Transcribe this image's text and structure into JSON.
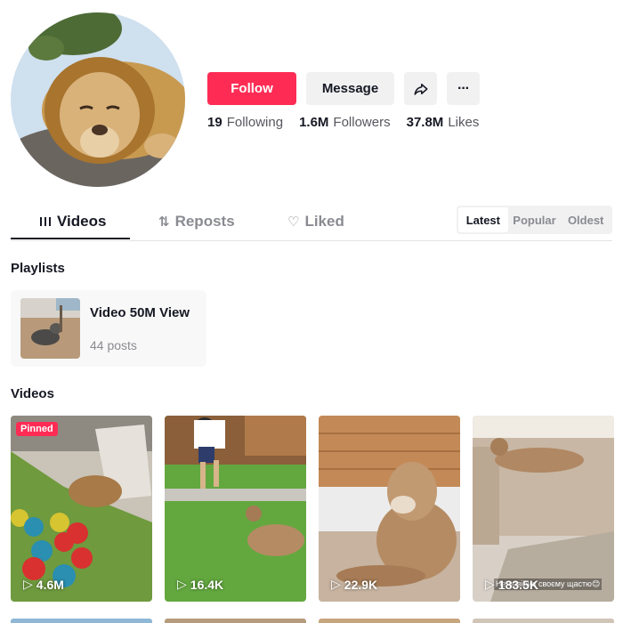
{
  "profile": {
    "avatar_alt": "lion-avatar"
  },
  "actions": {
    "follow_label": "Follow",
    "message_label": "Message",
    "share_icon": "share-icon",
    "more_label": "···"
  },
  "stats": [
    {
      "value": "19",
      "label": "Following"
    },
    {
      "value": "1.6M",
      "label": "Followers"
    },
    {
      "value": "37.8M",
      "label": "Likes"
    }
  ],
  "tabs": [
    {
      "label": "Videos",
      "icon": "grid-icon",
      "active": true
    },
    {
      "label": "Reposts",
      "icon": "repost-icon",
      "active": false
    },
    {
      "label": "Liked",
      "icon": "heart-icon",
      "active": false
    }
  ],
  "sort": [
    "Latest",
    "Popular",
    "Oldest"
  ],
  "playlists": {
    "title": "Playlists",
    "items": [
      {
        "name": "Video 50M View",
        "count": "44 posts"
      }
    ]
  },
  "videos": {
    "title": "Videos",
    "pinned_label": "Pinned",
    "items": [
      {
        "views": "4.6M",
        "pinned": true
      },
      {
        "views": "16.4K",
        "pinned": false
      },
      {
        "views": "22.9K",
        "pinned": false
      },
      {
        "views": "183.5K",
        "pinned": false,
        "caption": "Не повірив своєму щастю😊"
      }
    ]
  },
  "colors": {
    "accent": "#fe2c55",
    "text": "#161823",
    "muted": "#8a8b91"
  }
}
